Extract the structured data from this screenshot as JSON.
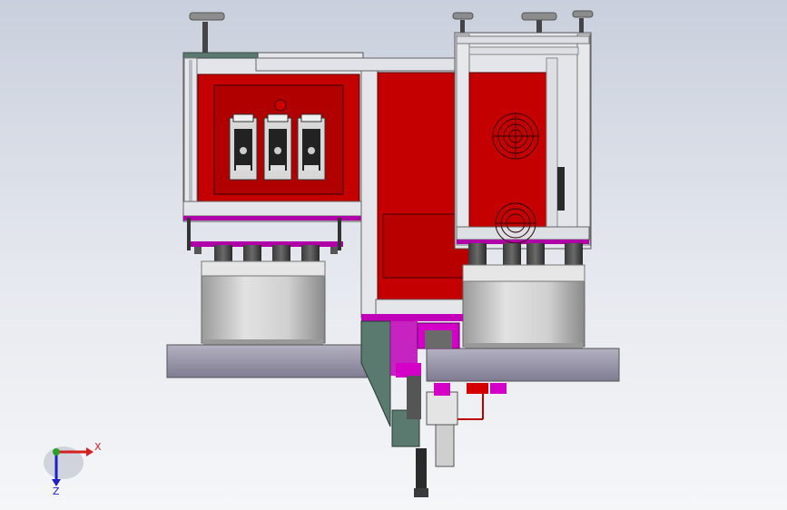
{
  "colors": {
    "background_top": "#c9cfdc",
    "background_bottom": "#f5f6f8",
    "frame": "#d9dde3",
    "panel_red": "#c40000",
    "accent_magenta": "#d400c8",
    "drum": "#d6d6d6",
    "base_plate": "#9b98ac",
    "bracket": "#5a7a70",
    "axis_x": "#d62020",
    "axis_y": "#2aa02a",
    "axis_z": "#2020c8"
  },
  "triad": {
    "x_label": "X",
    "z_label": "Z"
  }
}
